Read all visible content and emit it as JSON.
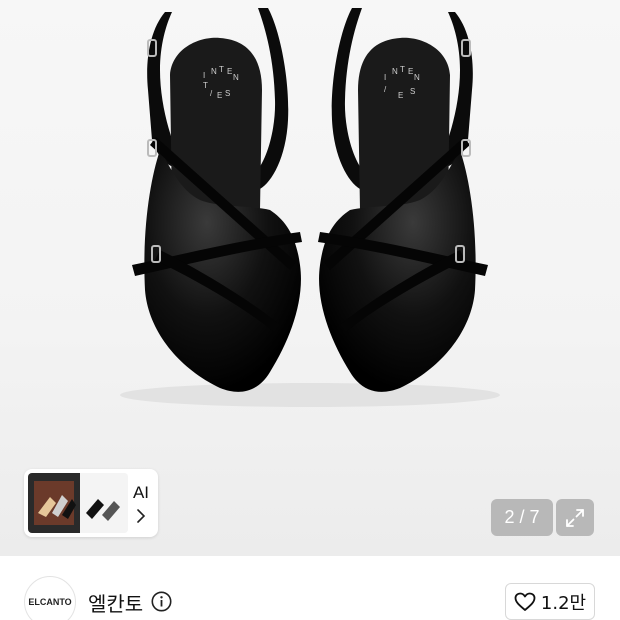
{
  "product": {
    "insole_brand_letters": [
      "I",
      "N",
      "T",
      "E",
      "N",
      "T",
      "I",
      "E",
      "S",
      "/",
      "/",
      "E",
      "S"
    ]
  },
  "gallery": {
    "page_counter": "2 / 7"
  },
  "ai_chip": {
    "label": "AI"
  },
  "store": {
    "logo_text": "ELCANTO",
    "name": "엘칸토"
  },
  "like": {
    "count": "1.2만"
  },
  "icons": {
    "chevron": "chevron-right-icon",
    "expand": "expand-icon",
    "info": "info-icon",
    "heart": "heart-icon"
  }
}
